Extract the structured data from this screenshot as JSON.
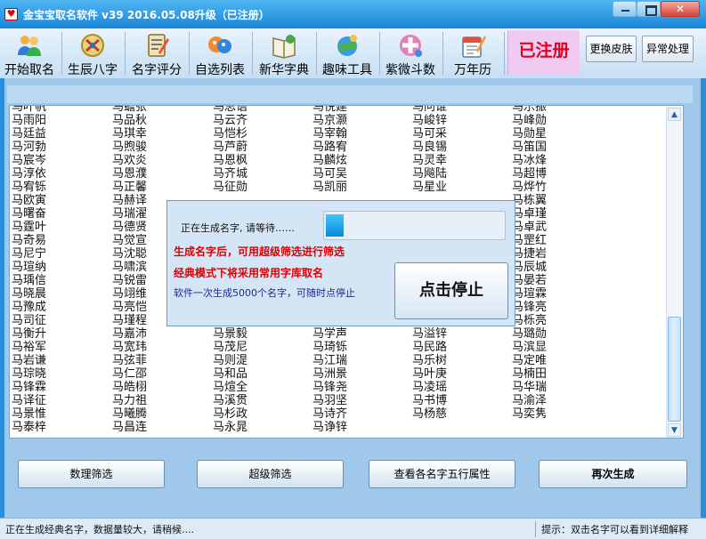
{
  "window": {
    "title": "金宝宝取名软件 v39  2016.05.08升级（已注册）"
  },
  "toolbar": {
    "items": [
      {
        "label": "开始取名",
        "icon": "users-icon"
      },
      {
        "label": "生辰八字",
        "icon": "eight-characters-icon"
      },
      {
        "label": "名字评分",
        "icon": "score-icon"
      },
      {
        "label": "自选列表",
        "icon": "list-icon"
      },
      {
        "label": "新华字典",
        "icon": "dictionary-icon"
      },
      {
        "label": "趣味工具",
        "icon": "tools-icon"
      },
      {
        "label": "紫微斗数",
        "icon": "astrology-icon"
      },
      {
        "label": "万年历",
        "icon": "calendar-icon"
      }
    ],
    "registered_label": "已注册",
    "skin_label": "更换皮肤",
    "exception_label": "异常处理"
  },
  "names": {
    "columns": [
      [
        "马叶帆",
        "马雨阳",
        "马廷益",
        "马河勃",
        "马宸岑",
        "马淳依",
        "马宥铄",
        "马欧寅",
        "马曙奋",
        "马霆叶",
        "马奇易",
        "马尼宁",
        "马瑄纳",
        "马瑀信",
        "马晓晨",
        "马豫成",
        "马司征",
        "马衡升",
        "马裕军",
        "马岩谦",
        "马琮晓",
        "马锋霖",
        "马译征",
        "马景惟",
        "马泰梓"
      ],
      [
        "马蟾张",
        "马品秋",
        "马琪幸",
        "马煦骏",
        "马欢炎",
        "马恩濮",
        "马正馨",
        "马赫译",
        "马瑞濯",
        "马德贤",
        "马觉宣",
        "马沈聪",
        "马啸滨",
        "马锐雷",
        "马翊维",
        "马亮恺",
        "马瑾程",
        "马嘉沛",
        "马宽玮",
        "马弦菲",
        "马仁邵",
        "马皓栩",
        "马力祖",
        "马曦腾",
        "马昌连"
      ],
      [
        "马思语",
        "马云齐",
        "马恺杉",
        "马芦蔚",
        "马恩枫",
        "马齐城",
        "马征勋",
        "",
        "",
        "",
        "",
        "",
        "",
        "",
        "",
        "",
        "",
        "马景毅",
        "马茂尼",
        "马则湜",
        "马和品",
        "马煊全",
        "马溪贯",
        "马杉政",
        "马永晁"
      ],
      [
        "马悦建",
        "马京灏",
        "马宰翰",
        "马路宥",
        "马麟炫",
        "马可吴",
        "马凯丽",
        "",
        "",
        "",
        "",
        "",
        "",
        "",
        "",
        "",
        "",
        "马学声",
        "马琦铄",
        "马江瑞",
        "马洲景",
        "马锋尧",
        "马羽坚",
        "马诗齐",
        "马诤锌"
      ],
      [
        "马问谁",
        "马峻锌",
        "马可采",
        "马良锡",
        "马灵幸",
        "马飚陆",
        "马星业",
        "",
        "",
        "",
        "",
        "",
        "",
        "",
        "",
        "",
        "",
        "马溢锌",
        "马民路",
        "马乐树",
        "马叶庚",
        "马凌瑶",
        "马书博",
        "马杨慈",
        ""
      ],
      [
        "马乐振",
        "马峰勋",
        "马勋星",
        "马笛国",
        "马冰烽",
        "马超博",
        "马烨竹",
        "马栋翼",
        "马卓瑾",
        "马卓武",
        "马罡红",
        "马捷岩",
        "马辰城",
        "马晏若",
        "马瑄霖",
        "马锋亮",
        "马栎亮",
        "马璐勋",
        "马滨显",
        "马定唯",
        "马楠田",
        "马华瑞",
        "马渝泽",
        "马奕隽",
        ""
      ]
    ]
  },
  "dialog": {
    "wait_text": "正在生成名字, 请等待……",
    "progress": 0.1,
    "hint_filter": "生成名字后，可用超级筛选进行筛选",
    "hint_classic": "经典模式下将采用常用字库取名",
    "hint_count": "软件一次生成5000个名字，可随时点停止",
    "stop_label": "点击停止"
  },
  "buttons": {
    "number_filter": "数理筛选",
    "super_filter": "超级筛选",
    "wuxing": "查看各名字五行属性",
    "regenerate": "再次生成"
  },
  "status": {
    "left": "正在生成经典名字，数据量较大，请稍候....",
    "right": "提示：双击名字可以看到详细解释"
  },
  "colors": {
    "title_bar": "#1a86d8",
    "registered_bg": "#f1caf2",
    "registered_text": "#e00020",
    "hint_red": "#e00000",
    "progress_fill": "#0a8ad6"
  }
}
